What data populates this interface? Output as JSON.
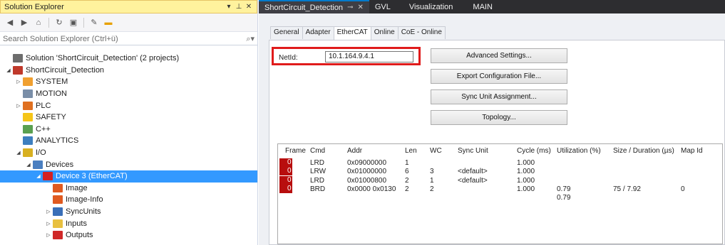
{
  "solution_explorer": {
    "title": "Solution Explorer",
    "search_placeholder": "Search Solution Explorer (Ctrl+ü)",
    "tree": [
      {
        "label": "Solution 'ShortCircuit_Detection' (2 projects)",
        "depth": 0,
        "arrow": "",
        "icon": "solution-icon",
        "color": "#6d6d6d"
      },
      {
        "label": "ShortCircuit_Detection",
        "depth": 0,
        "arrow": "◢",
        "icon": "project-icon",
        "color": "#c0392b"
      },
      {
        "label": "SYSTEM",
        "depth": 1,
        "arrow": "▷",
        "icon": "system-icon",
        "color": "#f0a030"
      },
      {
        "label": "MOTION",
        "depth": 1,
        "arrow": "",
        "icon": "motion-icon",
        "color": "#7a8ea8"
      },
      {
        "label": "PLC",
        "depth": 1,
        "arrow": "▷",
        "icon": "plc-icon",
        "color": "#e07020"
      },
      {
        "label": "SAFETY",
        "depth": 1,
        "arrow": "",
        "icon": "safety-icon",
        "color": "#f5c518"
      },
      {
        "label": "C++",
        "depth": 1,
        "arrow": "",
        "icon": "cpp-icon",
        "color": "#5aa050"
      },
      {
        "label": "ANALYTICS",
        "depth": 1,
        "arrow": "",
        "icon": "analytics-icon",
        "color": "#3d7fbf"
      },
      {
        "label": "I/O",
        "depth": 1,
        "arrow": "◢",
        "icon": "io-icon",
        "color": "#d8b020"
      },
      {
        "label": "Devices",
        "depth": 2,
        "arrow": "◢",
        "icon": "devices-icon",
        "color": "#4a7fc0"
      },
      {
        "label": "Device 3 (EtherCAT)",
        "depth": 3,
        "arrow": "◢",
        "icon": "ethercat-device-icon",
        "color": "#d42020",
        "selected": true
      },
      {
        "label": "Image",
        "depth": 4,
        "arrow": "",
        "icon": "image-icon",
        "color": "#e05a20"
      },
      {
        "label": "Image-Info",
        "depth": 4,
        "arrow": "",
        "icon": "image-info-icon",
        "color": "#e05a20"
      },
      {
        "label": "SyncUnits",
        "depth": 4,
        "arrow": "▷",
        "icon": "syncunits-icon",
        "color": "#3a6fb8"
      },
      {
        "label": "Inputs",
        "depth": 4,
        "arrow": "▷",
        "icon": "inputs-icon",
        "color": "#e8c040"
      },
      {
        "label": "Outputs",
        "depth": 4,
        "arrow": "▷",
        "icon": "outputs-icon",
        "color": "#d02828"
      }
    ]
  },
  "doc_tabs": [
    {
      "label": "ShortCircuit_Detection",
      "active": true
    },
    {
      "label": "GVL",
      "active": false
    },
    {
      "label": "Visualization",
      "active": false
    },
    {
      "label": "MAIN",
      "active": false
    }
  ],
  "sub_tabs": [
    "General",
    "Adapter",
    "EtherCAT",
    "Online",
    "CoE - Online"
  ],
  "active_sub_tab": "EtherCAT",
  "netid": {
    "label": "NetId:",
    "value": "10.1.164.9.4.1"
  },
  "buttons": {
    "advanced": "Advanced Settings...",
    "export": "Export Configuration File...",
    "sync": "Sync Unit Assignment...",
    "topology": "Topology..."
  },
  "frames_table": {
    "headers": [
      "Frame",
      "Cmd",
      "Addr",
      "Len",
      "WC",
      "Sync Unit",
      "Cycle (ms)",
      "Utilization (%)",
      "Size / Duration (µs)",
      "Map Id"
    ],
    "rows": [
      [
        "0",
        "LRD",
        "0x09000000",
        "1",
        "",
        "",
        "1.000",
        "",
        "",
        ""
      ],
      [
        "0",
        "LRW",
        "0x01000000",
        "6",
        "3",
        "<default>",
        "1.000",
        "",
        "",
        ""
      ],
      [
        "0",
        "LRD",
        "0x01000800",
        "2",
        "1",
        "<default>",
        "1.000",
        "",
        "",
        ""
      ],
      [
        "0",
        "BRD",
        "0x0000 0x0130",
        "2",
        "2",
        "",
        "1.000",
        "0.79",
        "75 / 7.92",
        "0"
      ],
      [
        "",
        "",
        "",
        "",
        "",
        "",
        "",
        "0.79",
        "",
        ""
      ]
    ]
  },
  "colors": {
    "accent": "#007acc",
    "selection": "#3399ff",
    "highlight_box": "#e01b1b",
    "frame_marker": "#b80e0e"
  }
}
